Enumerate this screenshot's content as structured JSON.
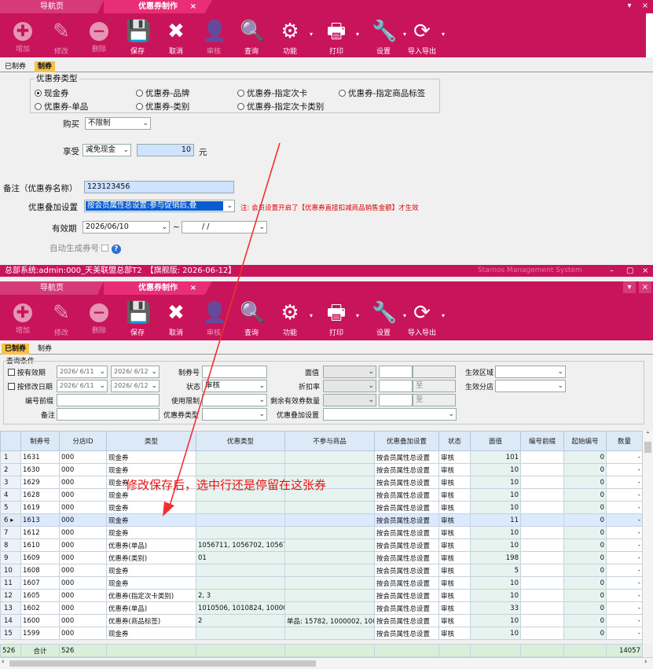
{
  "top": {
    "tabs": {
      "nav": "导航页",
      "active": "优惠券制作",
      "close": "×"
    },
    "toolbar": [
      {
        "name": "add",
        "label": "增加",
        "icon": "✚",
        "dim": true
      },
      {
        "name": "modify",
        "label": "修改",
        "icon": "✎",
        "dim": true
      },
      {
        "name": "delete",
        "label": "删除",
        "icon": "−",
        "dim": true
      },
      {
        "name": "save",
        "label": "保存",
        "icon": "💾",
        "dim": false
      },
      {
        "name": "cancel",
        "label": "取消",
        "icon": "✖",
        "dim": false
      },
      {
        "name": "audit",
        "label": "审核",
        "icon": "👤",
        "dim": true
      },
      {
        "name": "query",
        "label": "查询",
        "icon": "🔍",
        "dim": false
      },
      {
        "name": "function",
        "label": "功能",
        "icon": "⚙",
        "dim": false
      },
      {
        "name": "print",
        "label": "打印",
        "icon": "🖶",
        "dim": false
      },
      {
        "name": "settings",
        "label": "设置",
        "icon": "🔧",
        "dim": false
      },
      {
        "name": "import-export",
        "label": "导入导出",
        "icon": "⟳",
        "dim": false
      }
    ],
    "subtabs": [
      "已制券",
      "制券"
    ],
    "form": {
      "group_title": "优惠券类型",
      "radios": [
        "现金券",
        "优惠券-品牌",
        "优惠券-指定次卡",
        "优惠券-指定商品标签",
        "优惠券-单品",
        "优惠券-类别",
        "优惠券-指定次卡类别"
      ],
      "buy_label": "购买",
      "buy_value": "不限制",
      "enjoy_label": "享受",
      "enjoy_type": "减免现金",
      "enjoy_value": "10",
      "enjoy_unit": "元",
      "remark_label": "备注（优惠券名称）",
      "remark_value": "123123456",
      "stack_label": "优惠叠加设置",
      "stack_value": "按会员属性总设置:参与促销后,叠",
      "stack_note": "注: 会员设置开启了【优惠券直接扣减商品销售金额】才生效",
      "valid_label": "有效期",
      "valid_from": "2026/06/10",
      "valid_sep": "~",
      "valid_to": "/  /",
      "auto_label": "自动生成券号",
      "help": "?"
    }
  },
  "bottom": {
    "titlebar": {
      "text": "总部系统:admin:000_天美联盟总部T2　【旗舰版: 2026-06-12】",
      "brand": "Starnos Management System"
    },
    "subtabs": [
      "已制券",
      "制券"
    ],
    "query": {
      "title": "查询条件",
      "by_valid": "按有效期",
      "by_modify": "按修改日期",
      "d1": "2026/ 6/11",
      "d2": "2026/ 6/12",
      "d3": "2026/ 6/11",
      "d4": "2026/ 6/12",
      "code_prefix": "编号前缀",
      "remark": "备注",
      "voucher_no": "制券号",
      "status": "状态",
      "status_value": "审核",
      "use_limit": "使用限制",
      "coupon_type": "优惠券类型",
      "face_value": "面值",
      "discount": "折扣率",
      "remain": "剩余有效券数量",
      "stack": "优惠叠加设置",
      "to": "至",
      "region": "生效区域",
      "branch": "生效分店"
    },
    "columns": [
      "制券号",
      "分店ID",
      "类型",
      "优惠类型",
      "不参与商品",
      "优惠叠加设置",
      "状态",
      "面值",
      "编号前缀",
      "起始编号",
      "数量"
    ],
    "rows": [
      [
        "1",
        "1631",
        "000",
        "现金券",
        "",
        "",
        "按会员属性总设置",
        "审核",
        "101",
        "",
        "0",
        "-"
      ],
      [
        "2",
        "1630",
        "000",
        "现金券",
        "",
        "",
        "按会员属性总设置",
        "审核",
        "10",
        "",
        "0",
        "-"
      ],
      [
        "3",
        "1629",
        "000",
        "现金券",
        "",
        "",
        "按会员属性总设置",
        "审核",
        "10",
        "",
        "0",
        "-"
      ],
      [
        "4",
        "1628",
        "000",
        "现金券",
        "",
        "",
        "按会员属性总设置",
        "审核",
        "10",
        "",
        "0",
        "-"
      ],
      [
        "5",
        "1619",
        "000",
        "现金券",
        "",
        "",
        "按会员属性总设置",
        "审核",
        "10",
        "",
        "0",
        "-"
      ],
      [
        "6",
        "1613",
        "000",
        "现金券",
        "",
        "",
        "按会员属性总设置",
        "审核",
        "11",
        "",
        "0",
        "-"
      ],
      [
        "7",
        "1612",
        "000",
        "现金券",
        "",
        "",
        "按会员属性总设置",
        "审核",
        "10",
        "",
        "0",
        "-"
      ],
      [
        "8",
        "1610",
        "000",
        "优惠券(单品)",
        "1056711, 1056702, 1056701, 1",
        "",
        "按会员属性总设置",
        "审核",
        "10",
        "",
        "0",
        "-"
      ],
      [
        "9",
        "1609",
        "000",
        "优惠券(类别)",
        "01",
        "",
        "按会员属性总设置",
        "审核",
        "198",
        "",
        "0",
        "-"
      ],
      [
        "10",
        "1608",
        "000",
        "现金券",
        "",
        "",
        "按会员属性总设置",
        "审核",
        "5",
        "",
        "0",
        "-"
      ],
      [
        "11",
        "1607",
        "000",
        "现金券",
        "",
        "",
        "按会员属性总设置",
        "审核",
        "10",
        "",
        "0",
        "-"
      ],
      [
        "12",
        "1605",
        "000",
        "优惠券(指定次卡类别)",
        "2, 3",
        "",
        "按会员属性总设置",
        "审核",
        "10",
        "",
        "0",
        "-"
      ],
      [
        "13",
        "1602",
        "000",
        "优惠券(单品)",
        "1010506, 1010824, 1000019",
        "",
        "按会员属性总设置",
        "审核",
        "33",
        "",
        "0",
        "-"
      ],
      [
        "14",
        "1600",
        "000",
        "优惠券(商品标签)",
        "2",
        "单品: 15782, 1000002, 10000",
        "按会员属性总设置",
        "审核",
        "10",
        "",
        "0",
        "-"
      ],
      [
        "15",
        "1599",
        "000",
        "现金券",
        "",
        "",
        "按会员属性总设置",
        "审核",
        "10",
        "",
        "0",
        "-"
      ]
    ],
    "footer": {
      "count": "526",
      "total_label": "合计",
      "total_id": "526",
      "total_qty": "14057"
    },
    "annotation": "修改保存后，选中行还是停留在这张券"
  }
}
